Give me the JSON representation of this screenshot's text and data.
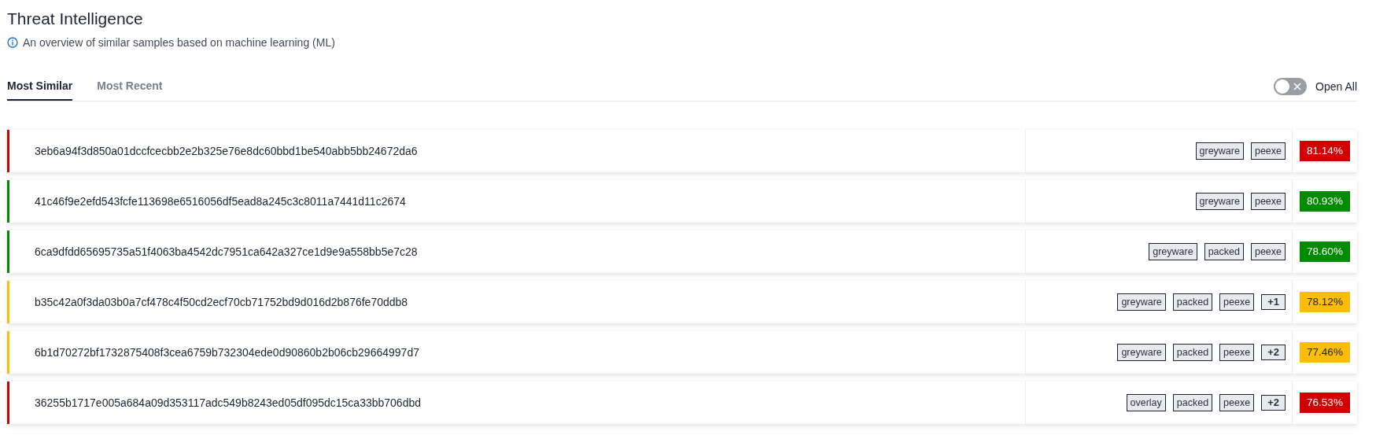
{
  "header": {
    "title": "Threat Intelligence",
    "subtitle": "An overview of similar samples based on machine learning (ML)"
  },
  "tabs": [
    {
      "label": "Most Similar",
      "selected": true
    },
    {
      "label": "Most Recent",
      "selected": false
    }
  ],
  "open_all": {
    "label": "Open All",
    "on": false
  },
  "samples": [
    {
      "hash": "3eb6a94f3d850a01dccfcecbb2e2b325e76e8dc60bbd1be540abb5bb24672da6",
      "tags": [
        "greyware",
        "peexe"
      ],
      "score": "81.14%",
      "color": "#d20000"
    },
    {
      "hash": "41c46f9e2efd543fcfe113698e6516056df5ead8a245c3c8011a7441d11c2674",
      "tags": [
        "greyware",
        "peexe"
      ],
      "score": "80.93%",
      "color": "#008a00"
    },
    {
      "hash": "6ca9dfdd65695735a51f4063ba4542dc7951ca642a327ce1d9e9a558bb5e7c28",
      "tags": [
        "greyware",
        "packed",
        "peexe"
      ],
      "score": "78.60%",
      "color": "#008a00"
    },
    {
      "hash": "b35c42a0f3da03b0a7cf478c4f50cd2ecf70cb71752bd9d016d2b876fe70ddb8",
      "tags": [
        "greyware",
        "packed",
        "peexe"
      ],
      "more": "+1",
      "score": "78.12%",
      "color": "#fbbc0c"
    },
    {
      "hash": "6b1d70272bf1732875408f3cea6759b732304ede0d90860b2b06cb29664997d7",
      "tags": [
        "greyware",
        "packed",
        "peexe"
      ],
      "more": "+2",
      "score": "77.46%",
      "color": "#fbbc0c"
    },
    {
      "hash": "36255b1717e005a684a09d353117adc549b8243ed05df095dc15ca33bb706dbd",
      "tags": [
        "overlay",
        "packed",
        "peexe"
      ],
      "more": "+2",
      "score": "76.53%",
      "color": "#d20000"
    }
  ]
}
